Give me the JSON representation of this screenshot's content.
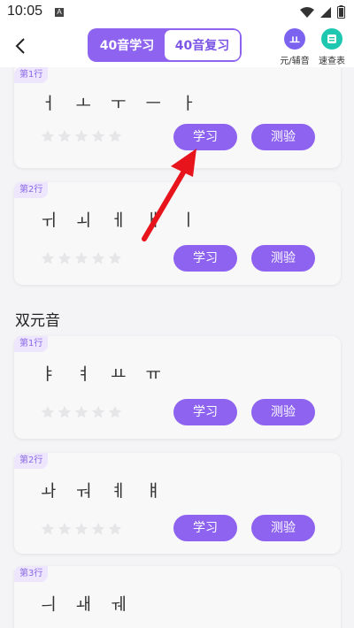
{
  "status": {
    "time": "10:05",
    "app_badge": "A"
  },
  "header": {
    "tabs": [
      {
        "label": "40音学习",
        "active": true
      },
      {
        "label": "40音复习",
        "active": false
      }
    ],
    "tools": [
      {
        "label": "元/辅音",
        "icon": "vowel-consonant-icon",
        "icon_text": "ㅛ",
        "color": "#7b63ef"
      },
      {
        "label": "速查表",
        "icon": "lookup-table-icon",
        "color": "#1ec8b0"
      }
    ]
  },
  "sections": [
    {
      "title": "",
      "cards": [
        {
          "tag": "第1行",
          "glyphs": "ㅓ ㅗ ㅜ ㅡ ㅏ",
          "stars": 0,
          "learn": "学习",
          "test": "测验"
        },
        {
          "tag": "第2行",
          "glyphs": "ㅟ ㅚ ㅔ ㅐ ㅣ",
          "stars": 0,
          "learn": "学习",
          "test": "测验"
        }
      ]
    },
    {
      "title": "双元音",
      "cards": [
        {
          "tag": "第1行",
          "glyphs": "ㅑ ㅕ ㅛ ㅠ",
          "stars": 0,
          "learn": "学习",
          "test": "测验"
        },
        {
          "tag": "第2行",
          "glyphs": "ㅘ ㅝ ㅖ ㅒ",
          "stars": 0,
          "learn": "学习",
          "test": "测验"
        },
        {
          "tag": "第3行",
          "glyphs": "ㅢ ㅙ ㅞ",
          "stars": 0,
          "learn": "",
          "test": ""
        }
      ]
    }
  ],
  "colors": {
    "accent": "#8d63ef",
    "tag_bg": "#ede6fd",
    "arrow": "#e8141c",
    "star_empty": "#e6e6e8"
  }
}
